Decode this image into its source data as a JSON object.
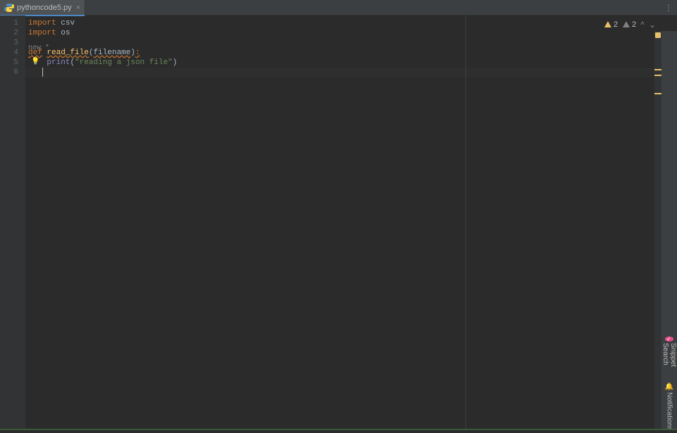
{
  "tab": {
    "filename": "pythoncode5.py",
    "close_glyph": "×"
  },
  "gutter": {
    "lines": [
      "1",
      "2",
      "3",
      "4",
      "5",
      "6"
    ]
  },
  "code": {
    "l1": {
      "kw": "import",
      "mod": "csv"
    },
    "l2": {
      "kw": "import",
      "mod": "os"
    },
    "l3_marker": "new *",
    "l4": {
      "def": "def",
      "fname": "read_file",
      "lpar": "(",
      "param": "filename",
      "rpar": ")",
      "colon": ":"
    },
    "l5": {
      "fn": "print",
      "lpar": "(",
      "str": "\"reading a json file\"",
      "rpar": ")"
    }
  },
  "inspections": {
    "warning1_count": "2",
    "warning2_count": "2"
  },
  "sidepanel": {
    "snippet_label": "Snippet Search",
    "notifications_label": "Notifications"
  },
  "icons": {
    "menu_glyph": "⋮",
    "chevup": "^",
    "chevdown": "⌄",
    "bulb": "💡",
    "bell": "🔔"
  }
}
